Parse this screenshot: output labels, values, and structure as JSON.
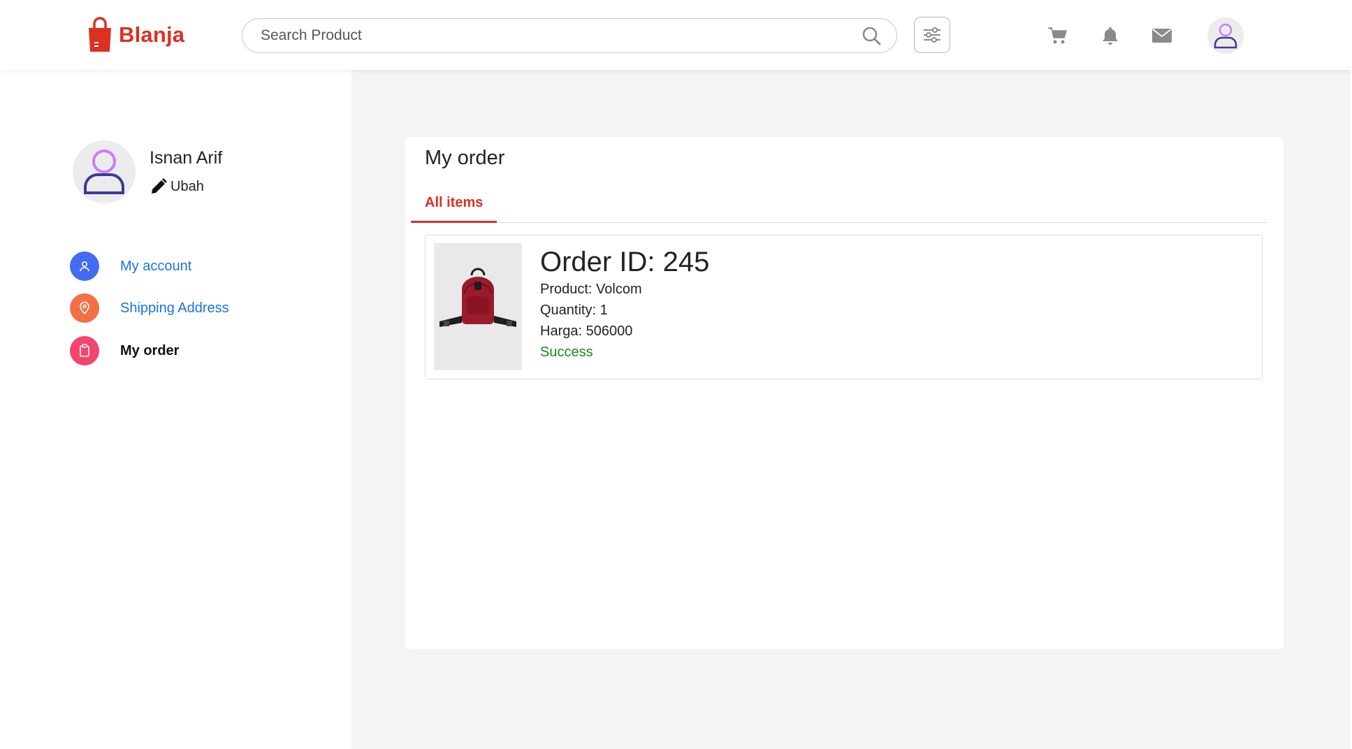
{
  "header": {
    "brand": "Blanja",
    "search_placeholder": "Search Product",
    "icons": [
      "logo-bag-icon",
      "search-icon",
      "filter-icon",
      "cart-icon",
      "bell-icon",
      "mail-icon",
      "user-avatar-icon"
    ]
  },
  "profile": {
    "name": "Isnan Arif",
    "edit_label": "Ubah"
  },
  "sidebar": {
    "items": [
      {
        "label": "My account",
        "icon": "user-icon",
        "color": "#456BF3",
        "active": false
      },
      {
        "label": "Shipping Address",
        "icon": "location-pin-icon",
        "color": "#F36F45",
        "active": false
      },
      {
        "label": "My order",
        "icon": "clipboard-icon",
        "color": "#F3456F",
        "active": true
      }
    ]
  },
  "main": {
    "title": "My order",
    "tabs": [
      {
        "label": "All items",
        "active": true
      }
    ],
    "orders": [
      {
        "order_id": "Order ID: 245",
        "product": "Product: Volcom",
        "quantity": "Quantity: 1",
        "price": "Harga: 506000",
        "status": "Success",
        "image": "backpack-product-image"
      }
    ]
  },
  "colors": {
    "brand": "#DB3022",
    "link": "#1a73e8",
    "status_success": "#1a8a1a",
    "main_bg": "#f4f4f4"
  }
}
